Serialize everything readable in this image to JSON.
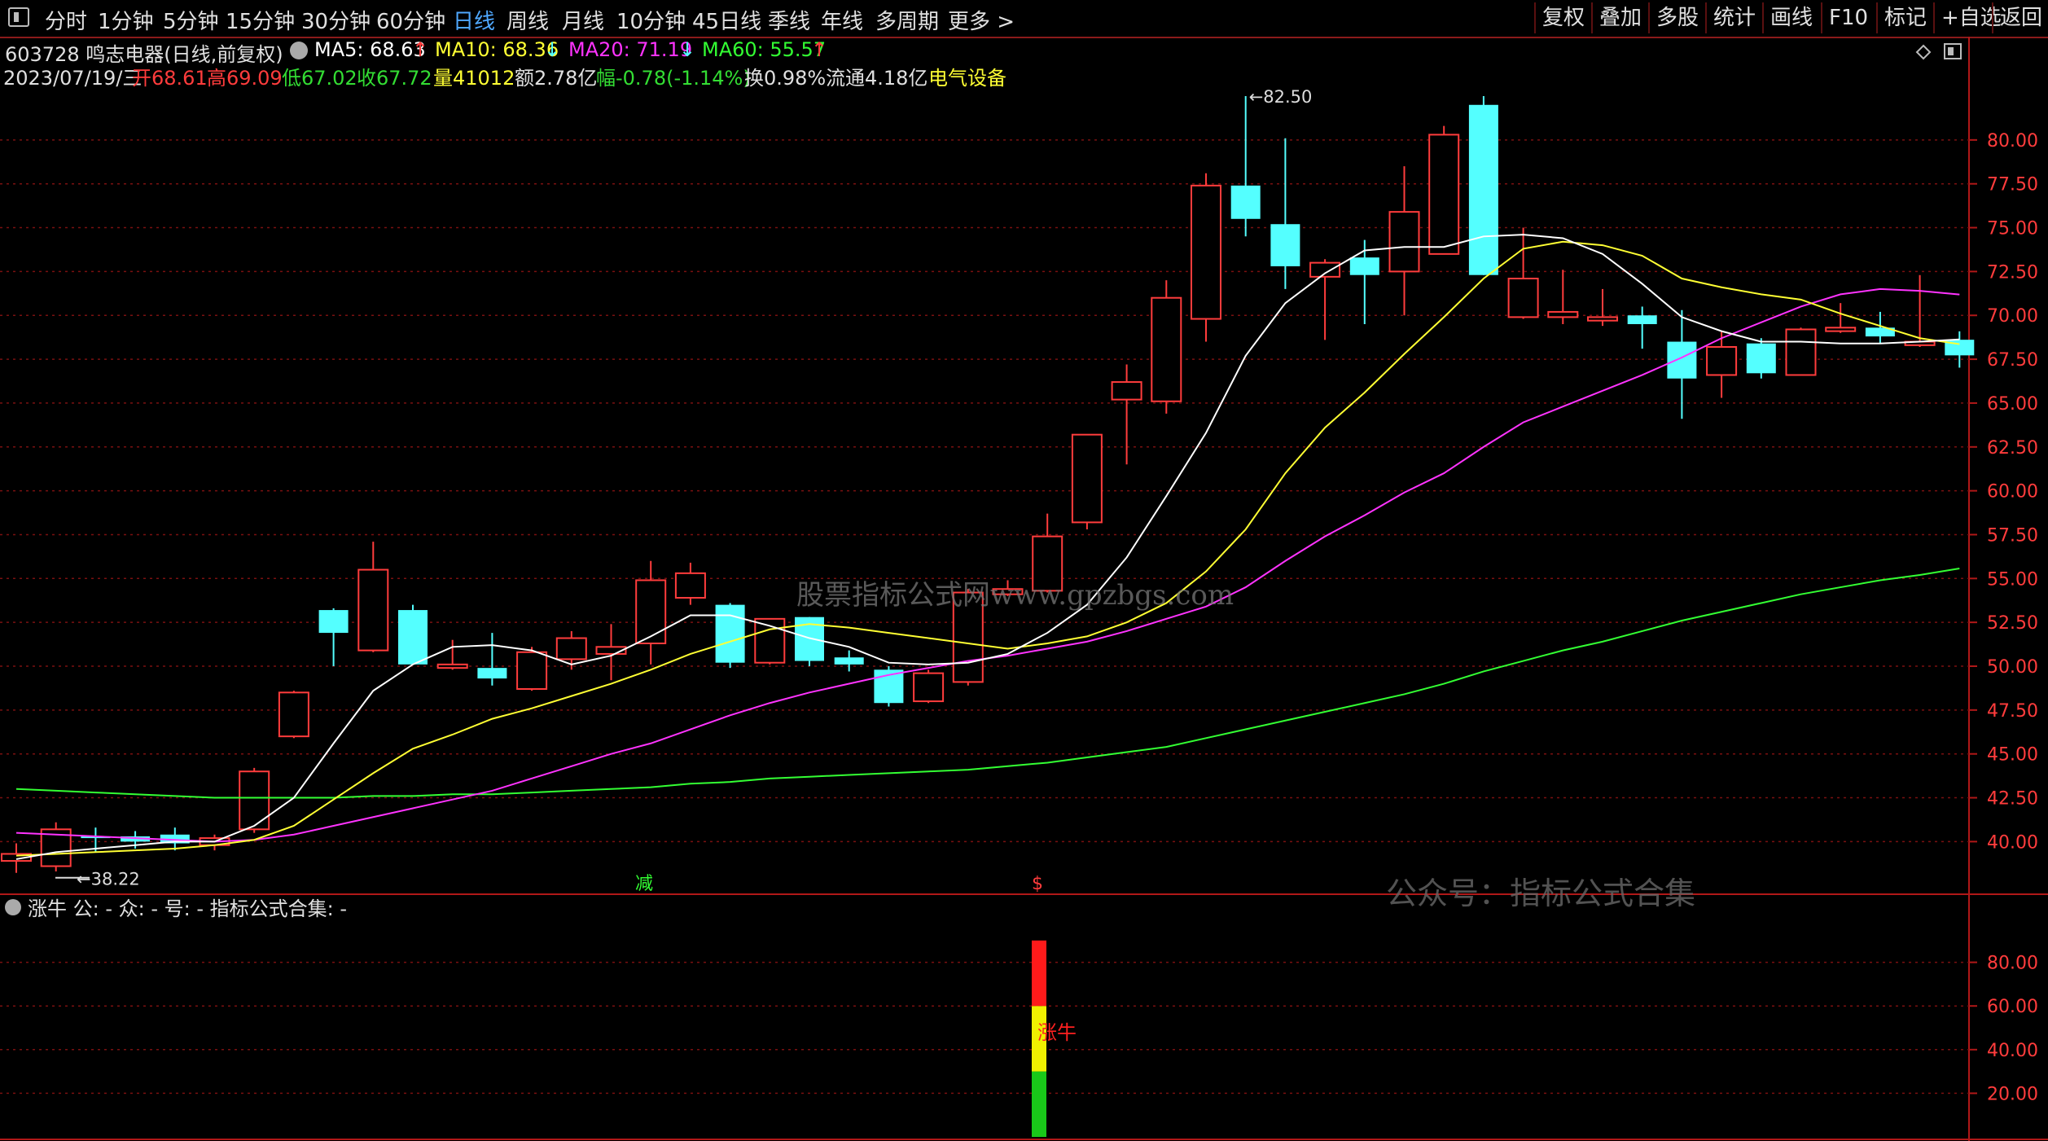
{
  "toolbar": {
    "periods": [
      "分时",
      "1分钟",
      "5分钟",
      "15分钟",
      "30分钟",
      "60分钟",
      "日线",
      "周线",
      "月线",
      "10分钟",
      "45日线",
      "季线",
      "年线",
      "多周期",
      "更多 >"
    ],
    "active_period": "日线",
    "right_buttons": [
      "复权",
      "叠加",
      "多股",
      "统计",
      "画线",
      "F10",
      "标记",
      "+自选",
      "返回"
    ]
  },
  "header": {
    "stock": "603728 鸣志电器(日线,前复权)",
    "ma5": "MA5: 68.63",
    "ma10": "MA10: 68.36",
    "ma20": "MA20: 71.19",
    "ma60": "MA60: 55.57",
    "date": "2023/07/19/三",
    "open": "开68.61",
    "high": "高69.09",
    "low": "低67.02",
    "close": "收67.72",
    "vol": "量41012",
    "amount": "额2.78亿",
    "change": "幅-0.78(-1.14%)",
    "turnover": "换0.98%",
    "float": "流通4.18亿",
    "sector": "电气设备"
  },
  "colors": {
    "up": "#ff3c3c",
    "down": "#54ffff",
    "ma5": "#ffffff",
    "ma10": "#ffff33",
    "ma20": "#ff33ff",
    "ma60": "#33ff33",
    "axis": "#b01818",
    "grid": "#7a1010"
  },
  "watermark": "股票指标公式网www.gpzbgs.com",
  "watermark2": "公众号：指标公式合集",
  "marks": {
    "jian": "减",
    "dollar": "$"
  },
  "indicator": {
    "title": "涨牛  公: -  众: -  号: -  指标公式合集: -",
    "bar_label": "涨牛",
    "yticks": [
      "80.00",
      "60.00",
      "40.00",
      "20.00"
    ],
    "segments": [
      {
        "from": 0,
        "to": 30,
        "color": "#19c819"
      },
      {
        "from": 30,
        "to": 60,
        "color": "#f0f000"
      },
      {
        "from": 60,
        "to": 90,
        "color": "#ff1a1a"
      }
    ]
  },
  "chart_data": {
    "type": "candlestick",
    "ylim": [
      37.0,
      82.5
    ],
    "yticks": [
      "80.00",
      "77.50",
      "75.00",
      "72.50",
      "70.00",
      "67.50",
      "65.00",
      "62.50",
      "60.00",
      "57.50",
      "55.00",
      "52.50",
      "50.00",
      "47.50",
      "45.00",
      "42.50",
      "40.00"
    ],
    "low_label": "38.22",
    "high_label": "82.50",
    "candles": [
      {
        "o": 38.9,
        "h": 39.9,
        "l": 38.22,
        "c": 39.3
      },
      {
        "o": 38.6,
        "h": 41.1,
        "l": 38.3,
        "c": 40.7
      },
      {
        "o": 40.3,
        "h": 40.8,
        "l": 39.4,
        "c": 40.2
      },
      {
        "o": 40.3,
        "h": 40.6,
        "l": 39.6,
        "c": 40.0
      },
      {
        "o": 40.4,
        "h": 40.8,
        "l": 39.5,
        "c": 39.9
      },
      {
        "o": 39.8,
        "h": 40.4,
        "l": 39.5,
        "c": 40.2
      },
      {
        "o": 40.7,
        "h": 44.2,
        "l": 40.5,
        "c": 44.0
      },
      {
        "o": 46.0,
        "h": 48.6,
        "l": 45.9,
        "c": 48.5
      },
      {
        "o": 53.2,
        "h": 53.3,
        "l": 50.0,
        "c": 51.9
      },
      {
        "o": 50.9,
        "h": 57.1,
        "l": 50.8,
        "c": 55.5
      },
      {
        "o": 53.2,
        "h": 53.5,
        "l": 50.1,
        "c": 50.1
      },
      {
        "o": 49.9,
        "h": 51.5,
        "l": 49.8,
        "c": 50.1
      },
      {
        "o": 49.9,
        "h": 51.9,
        "l": 48.9,
        "c": 49.3
      },
      {
        "o": 48.7,
        "h": 51.1,
        "l": 48.6,
        "c": 50.8
      },
      {
        "o": 50.4,
        "h": 52.0,
        "l": 49.8,
        "c": 51.6
      },
      {
        "o": 50.7,
        "h": 52.4,
        "l": 49.2,
        "c": 51.1
      },
      {
        "o": 51.3,
        "h": 56.0,
        "l": 50.1,
        "c": 54.9
      },
      {
        "o": 53.9,
        "h": 55.9,
        "l": 53.5,
        "c": 55.3
      },
      {
        "o": 53.5,
        "h": 53.6,
        "l": 49.9,
        "c": 50.2
      },
      {
        "o": 50.2,
        "h": 52.7,
        "l": 50.1,
        "c": 52.7
      },
      {
        "o": 52.8,
        "h": 52.8,
        "l": 50.0,
        "c": 50.3
      },
      {
        "o": 50.5,
        "h": 50.9,
        "l": 49.7,
        "c": 50.1
      },
      {
        "o": 49.8,
        "h": 50.0,
        "l": 47.7,
        "c": 47.9
      },
      {
        "o": 48.0,
        "h": 49.8,
        "l": 47.9,
        "c": 49.6
      },
      {
        "o": 49.1,
        "h": 54.4,
        "l": 48.9,
        "c": 54.2
      },
      {
        "o": 54.1,
        "h": 54.9,
        "l": 54.0,
        "c": 54.4
      },
      {
        "o": 54.3,
        "h": 58.7,
        "l": 54.2,
        "c": 57.4
      },
      {
        "o": 58.2,
        "h": 63.2,
        "l": 57.8,
        "c": 63.2
      },
      {
        "o": 65.2,
        "h": 67.2,
        "l": 61.5,
        "c": 66.2
      },
      {
        "o": 65.1,
        "h": 72.0,
        "l": 64.4,
        "c": 71.0
      },
      {
        "o": 69.8,
        "h": 78.1,
        "l": 68.5,
        "c": 77.4
      },
      {
        "o": 77.4,
        "h": 82.5,
        "l": 74.5,
        "c": 75.5
      },
      {
        "o": 75.2,
        "h": 80.1,
        "l": 71.5,
        "c": 72.8
      },
      {
        "o": 72.2,
        "h": 73.2,
        "l": 68.6,
        "c": 73.0
      },
      {
        "o": 73.3,
        "h": 74.3,
        "l": 69.5,
        "c": 72.3
      },
      {
        "o": 72.5,
        "h": 78.5,
        "l": 70.0,
        "c": 75.9
      },
      {
        "o": 73.5,
        "h": 80.8,
        "l": 73.5,
        "c": 80.3
      },
      {
        "o": 82.0,
        "h": 82.5,
        "l": 72.3,
        "c": 72.3
      },
      {
        "o": 69.9,
        "h": 75.0,
        "l": 69.8,
        "c": 72.1
      },
      {
        "o": 69.9,
        "h": 72.6,
        "l": 69.5,
        "c": 70.2
      },
      {
        "o": 69.7,
        "h": 71.5,
        "l": 69.4,
        "c": 69.9
      },
      {
        "o": 70.0,
        "h": 70.5,
        "l": 68.1,
        "c": 69.5
      },
      {
        "o": 68.5,
        "h": 70.3,
        "l": 64.1,
        "c": 66.4
      },
      {
        "o": 66.6,
        "h": 69.1,
        "l": 65.3,
        "c": 68.2
      },
      {
        "o": 68.4,
        "h": 68.7,
        "l": 66.4,
        "c": 66.7
      },
      {
        "o": 66.6,
        "h": 69.3,
        "l": 66.6,
        "c": 69.2
      },
      {
        "o": 69.1,
        "h": 70.7,
        "l": 69.0,
        "c": 69.3
      },
      {
        "o": 69.3,
        "h": 70.2,
        "l": 68.4,
        "c": 68.8
      },
      {
        "o": 68.3,
        "h": 72.3,
        "l": 68.2,
        "c": 68.5
      },
      {
        "o": 68.61,
        "h": 69.09,
        "l": 67.02,
        "c": 67.72
      }
    ],
    "ma5": [
      39.0,
      39.4,
      39.6,
      39.8,
      40.0,
      40.0,
      40.9,
      42.5,
      45.6,
      48.6,
      50.1,
      51.1,
      51.2,
      50.9,
      50.1,
      50.6,
      51.7,
      52.9,
      52.9,
      52.3,
      51.6,
      51.1,
      50.2,
      50.1,
      50.2,
      50.7,
      51.9,
      53.5,
      56.2,
      59.7,
      63.3,
      67.7,
      70.7,
      72.4,
      73.7,
      73.9,
      73.9,
      74.5,
      74.6,
      74.4,
      73.5,
      71.8,
      69.9,
      69.1,
      68.5,
      68.5,
      68.4,
      68.4,
      68.5,
      68.63
    ],
    "ma10": [
      39.2,
      39.3,
      39.4,
      39.5,
      39.6,
      39.8,
      40.1,
      40.9,
      42.4,
      43.9,
      45.3,
      46.1,
      47.0,
      47.6,
      48.3,
      49.0,
      49.8,
      50.7,
      51.4,
      52.1,
      52.4,
      52.2,
      51.9,
      51.6,
      51.3,
      51.0,
      51.3,
      51.7,
      52.5,
      53.6,
      55.4,
      57.8,
      61.0,
      63.6,
      65.6,
      67.8,
      69.9,
      72.1,
      73.8,
      74.2,
      74.0,
      73.4,
      72.1,
      71.6,
      71.2,
      70.9,
      70.1,
      69.4,
      68.7,
      68.36
    ],
    "ma20": [
      40.5,
      40.4,
      40.3,
      40.2,
      40.1,
      40.0,
      40.1,
      40.4,
      40.9,
      41.4,
      41.9,
      42.4,
      42.9,
      43.6,
      44.3,
      45.0,
      45.6,
      46.4,
      47.2,
      47.9,
      48.5,
      49.0,
      49.5,
      49.9,
      50.3,
      50.6,
      51.0,
      51.4,
      52.0,
      52.7,
      53.4,
      54.5,
      56.0,
      57.4,
      58.6,
      59.9,
      61.0,
      62.5,
      63.9,
      64.8,
      65.7,
      66.6,
      67.6,
      68.7,
      69.6,
      70.5,
      71.2,
      71.5,
      71.4,
      71.19
    ],
    "ma60": [
      43.0,
      42.9,
      42.8,
      42.7,
      42.6,
      42.5,
      42.5,
      42.5,
      42.5,
      42.6,
      42.6,
      42.7,
      42.7,
      42.8,
      42.9,
      43.0,
      43.1,
      43.3,
      43.4,
      43.6,
      43.7,
      43.8,
      43.9,
      44.0,
      44.1,
      44.3,
      44.5,
      44.8,
      45.1,
      45.4,
      45.9,
      46.4,
      46.9,
      47.4,
      47.9,
      48.4,
      49.0,
      49.7,
      50.3,
      50.9,
      51.4,
      52.0,
      52.6,
      53.1,
      53.6,
      54.1,
      54.5,
      54.9,
      55.2,
      55.57
    ]
  }
}
